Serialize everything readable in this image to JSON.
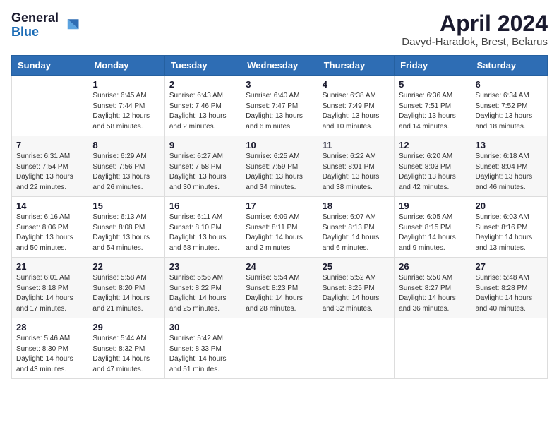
{
  "logo": {
    "general": "General",
    "blue": "Blue"
  },
  "title": "April 2024",
  "subtitle": "Davyd-Haradok, Brest, Belarus",
  "days_of_week": [
    "Sunday",
    "Monday",
    "Tuesday",
    "Wednesday",
    "Thursday",
    "Friday",
    "Saturday"
  ],
  "weeks": [
    [
      {
        "num": "",
        "info": ""
      },
      {
        "num": "1",
        "info": "Sunrise: 6:45 AM\nSunset: 7:44 PM\nDaylight: 12 hours\nand 58 minutes."
      },
      {
        "num": "2",
        "info": "Sunrise: 6:43 AM\nSunset: 7:46 PM\nDaylight: 13 hours\nand 2 minutes."
      },
      {
        "num": "3",
        "info": "Sunrise: 6:40 AM\nSunset: 7:47 PM\nDaylight: 13 hours\nand 6 minutes."
      },
      {
        "num": "4",
        "info": "Sunrise: 6:38 AM\nSunset: 7:49 PM\nDaylight: 13 hours\nand 10 minutes."
      },
      {
        "num": "5",
        "info": "Sunrise: 6:36 AM\nSunset: 7:51 PM\nDaylight: 13 hours\nand 14 minutes."
      },
      {
        "num": "6",
        "info": "Sunrise: 6:34 AM\nSunset: 7:52 PM\nDaylight: 13 hours\nand 18 minutes."
      }
    ],
    [
      {
        "num": "7",
        "info": "Sunrise: 6:31 AM\nSunset: 7:54 PM\nDaylight: 13 hours\nand 22 minutes."
      },
      {
        "num": "8",
        "info": "Sunrise: 6:29 AM\nSunset: 7:56 PM\nDaylight: 13 hours\nand 26 minutes."
      },
      {
        "num": "9",
        "info": "Sunrise: 6:27 AM\nSunset: 7:58 PM\nDaylight: 13 hours\nand 30 minutes."
      },
      {
        "num": "10",
        "info": "Sunrise: 6:25 AM\nSunset: 7:59 PM\nDaylight: 13 hours\nand 34 minutes."
      },
      {
        "num": "11",
        "info": "Sunrise: 6:22 AM\nSunset: 8:01 PM\nDaylight: 13 hours\nand 38 minutes."
      },
      {
        "num": "12",
        "info": "Sunrise: 6:20 AM\nSunset: 8:03 PM\nDaylight: 13 hours\nand 42 minutes."
      },
      {
        "num": "13",
        "info": "Sunrise: 6:18 AM\nSunset: 8:04 PM\nDaylight: 13 hours\nand 46 minutes."
      }
    ],
    [
      {
        "num": "14",
        "info": "Sunrise: 6:16 AM\nSunset: 8:06 PM\nDaylight: 13 hours\nand 50 minutes."
      },
      {
        "num": "15",
        "info": "Sunrise: 6:13 AM\nSunset: 8:08 PM\nDaylight: 13 hours\nand 54 minutes."
      },
      {
        "num": "16",
        "info": "Sunrise: 6:11 AM\nSunset: 8:10 PM\nDaylight: 13 hours\nand 58 minutes."
      },
      {
        "num": "17",
        "info": "Sunrise: 6:09 AM\nSunset: 8:11 PM\nDaylight: 14 hours\nand 2 minutes."
      },
      {
        "num": "18",
        "info": "Sunrise: 6:07 AM\nSunset: 8:13 PM\nDaylight: 14 hours\nand 6 minutes."
      },
      {
        "num": "19",
        "info": "Sunrise: 6:05 AM\nSunset: 8:15 PM\nDaylight: 14 hours\nand 9 minutes."
      },
      {
        "num": "20",
        "info": "Sunrise: 6:03 AM\nSunset: 8:16 PM\nDaylight: 14 hours\nand 13 minutes."
      }
    ],
    [
      {
        "num": "21",
        "info": "Sunrise: 6:01 AM\nSunset: 8:18 PM\nDaylight: 14 hours\nand 17 minutes."
      },
      {
        "num": "22",
        "info": "Sunrise: 5:58 AM\nSunset: 8:20 PM\nDaylight: 14 hours\nand 21 minutes."
      },
      {
        "num": "23",
        "info": "Sunrise: 5:56 AM\nSunset: 8:22 PM\nDaylight: 14 hours\nand 25 minutes."
      },
      {
        "num": "24",
        "info": "Sunrise: 5:54 AM\nSunset: 8:23 PM\nDaylight: 14 hours\nand 28 minutes."
      },
      {
        "num": "25",
        "info": "Sunrise: 5:52 AM\nSunset: 8:25 PM\nDaylight: 14 hours\nand 32 minutes."
      },
      {
        "num": "26",
        "info": "Sunrise: 5:50 AM\nSunset: 8:27 PM\nDaylight: 14 hours\nand 36 minutes."
      },
      {
        "num": "27",
        "info": "Sunrise: 5:48 AM\nSunset: 8:28 PM\nDaylight: 14 hours\nand 40 minutes."
      }
    ],
    [
      {
        "num": "28",
        "info": "Sunrise: 5:46 AM\nSunset: 8:30 PM\nDaylight: 14 hours\nand 43 minutes."
      },
      {
        "num": "29",
        "info": "Sunrise: 5:44 AM\nSunset: 8:32 PM\nDaylight: 14 hours\nand 47 minutes."
      },
      {
        "num": "30",
        "info": "Sunrise: 5:42 AM\nSunset: 8:33 PM\nDaylight: 14 hours\nand 51 minutes."
      },
      {
        "num": "",
        "info": ""
      },
      {
        "num": "",
        "info": ""
      },
      {
        "num": "",
        "info": ""
      },
      {
        "num": "",
        "info": ""
      }
    ]
  ]
}
